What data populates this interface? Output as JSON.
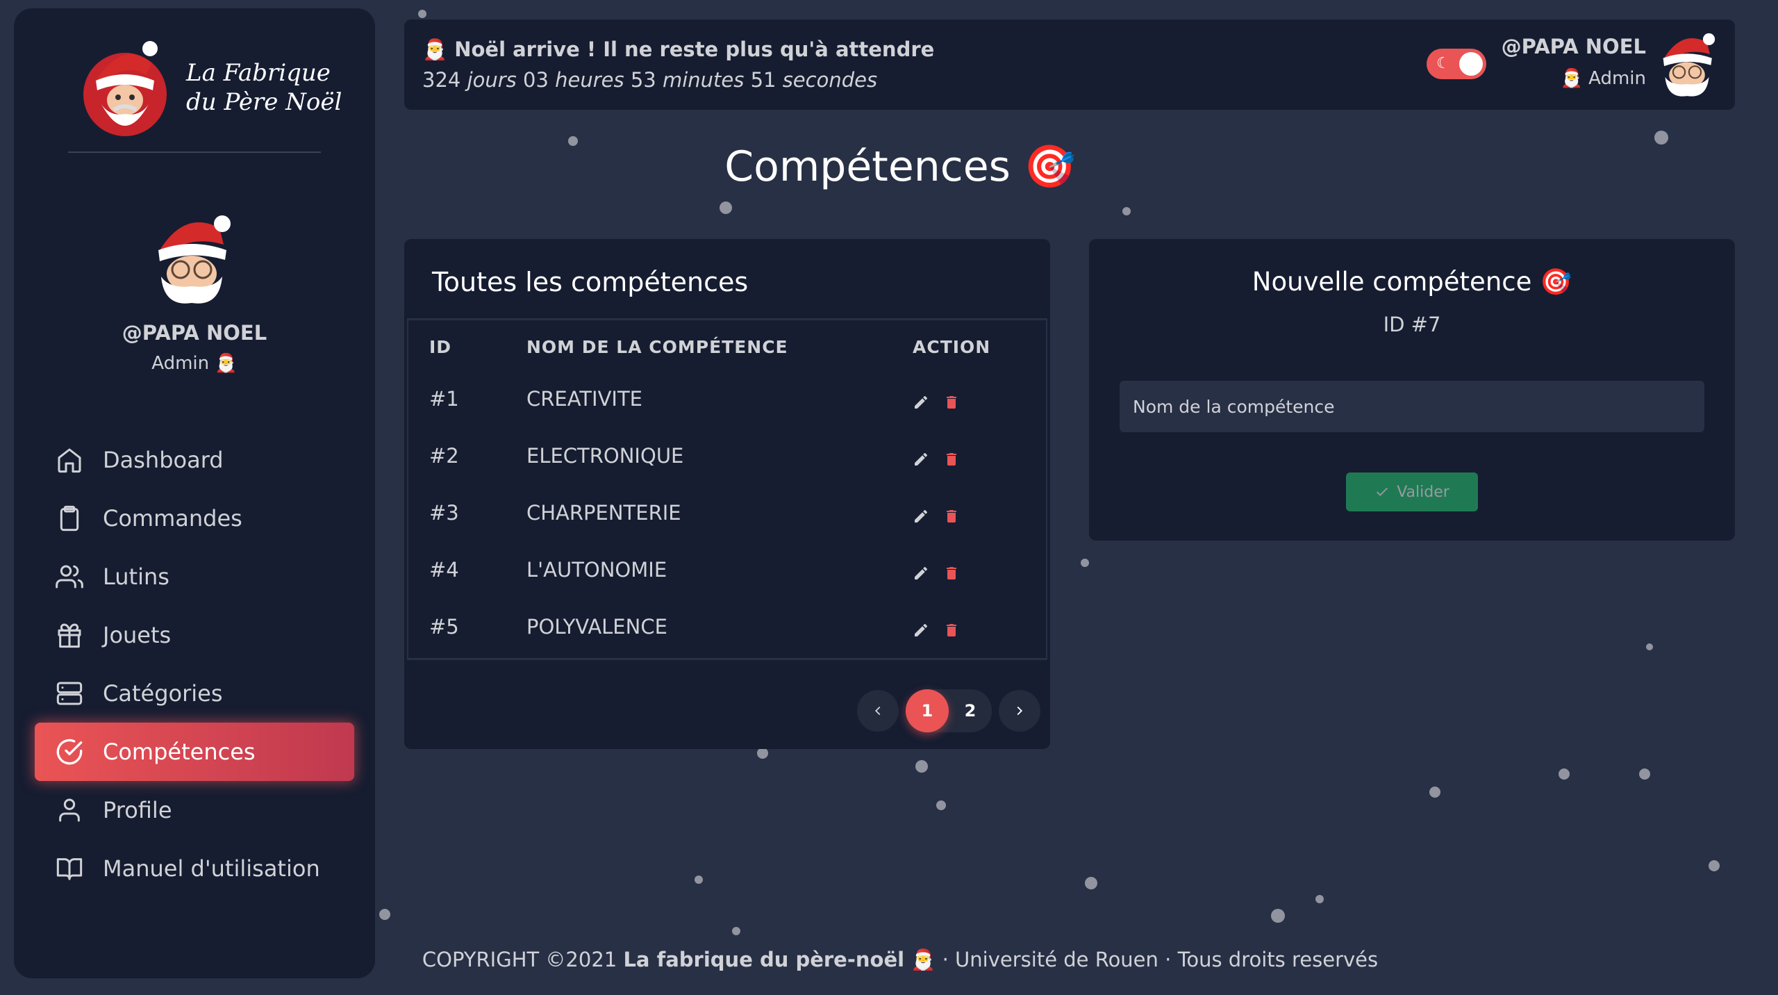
{
  "brand": {
    "line1": "La Fabrique",
    "line2": "du Père Noël"
  },
  "user": {
    "name": "@PAPA NOEL",
    "role": "Admin"
  },
  "sidebar": {
    "items": [
      {
        "label": "Dashboard",
        "icon": "home-icon"
      },
      {
        "label": "Commandes",
        "icon": "clipboard-icon"
      },
      {
        "label": "Lutins",
        "icon": "users-icon"
      },
      {
        "label": "Jouets",
        "icon": "gift-icon"
      },
      {
        "label": "Catégories",
        "icon": "server-icon"
      },
      {
        "label": "Compétences",
        "icon": "check-circle-icon",
        "active": true
      },
      {
        "label": "Profile",
        "icon": "user-icon"
      },
      {
        "label": "Manuel d'utilisation",
        "icon": "book-icon"
      }
    ]
  },
  "header": {
    "countdown_title": "Noël arrive ! Il ne reste plus qu'à attendre",
    "days": "324",
    "days_label": "jours",
    "hours": "03",
    "hours_label": "heures",
    "minutes": "53",
    "minutes_label": "minutes",
    "seconds": "51",
    "seconds_label": "secondes",
    "dark_mode": true
  },
  "page": {
    "title": "Compétences"
  },
  "table_card": {
    "title": "Toutes les compétences",
    "columns": [
      "ID",
      "NOM DE LA COMPÉTENCE",
      "ACTION"
    ],
    "rows": [
      {
        "id": "#1",
        "name": "CREATIVITE"
      },
      {
        "id": "#2",
        "name": "ELECTRONIQUE"
      },
      {
        "id": "#3",
        "name": "CHARPENTERIE"
      },
      {
        "id": "#4",
        "name": "L'AUTONOMIE"
      },
      {
        "id": "#5",
        "name": "POLYVALENCE"
      }
    ],
    "pagination": {
      "pages": [
        "1",
        "2"
      ],
      "current": "1"
    }
  },
  "form_card": {
    "title": "Nouvelle compétence",
    "id_label": "ID #7",
    "input_placeholder": "Nom de la compétence",
    "submit_label": "Valider"
  },
  "footer": {
    "prefix": "COPYRIGHT ©2021",
    "brand": "La fabrique du père-noël",
    "suffix": "· Université de Rouen · Tous droits reservés"
  },
  "colors": {
    "accent": "#ea5455",
    "success": "#28c76f",
    "card": "#161d31",
    "background": "#283046"
  }
}
